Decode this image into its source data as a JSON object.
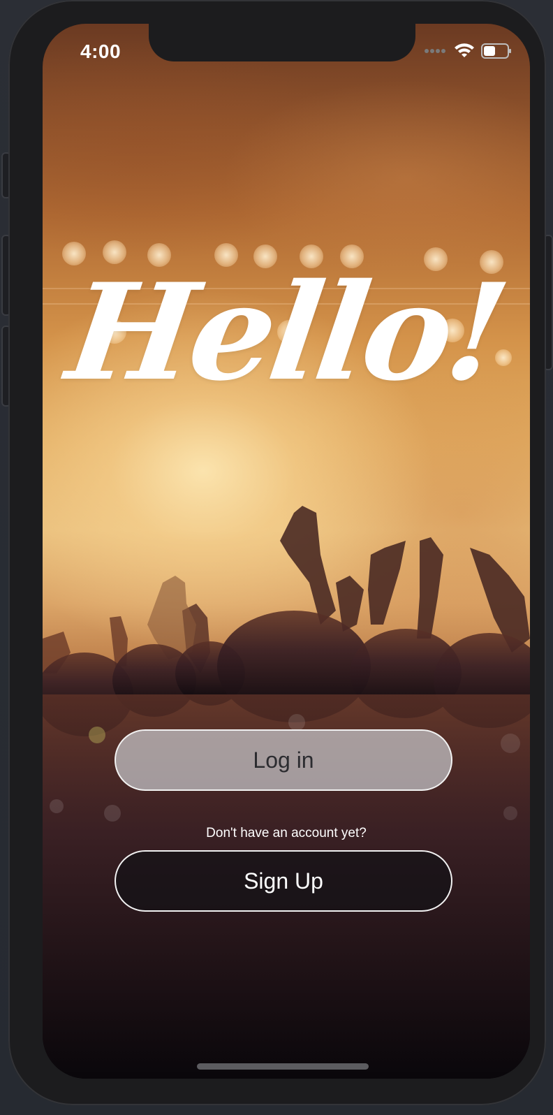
{
  "status_bar": {
    "time": "4:00",
    "icons": [
      "signal-dots-icon",
      "wifi-icon",
      "battery-icon"
    ]
  },
  "welcome": {
    "title": "Hello!"
  },
  "actions": {
    "login_label": "Log in",
    "no_account_text": "Don't have an account yet?",
    "signup_label": "Sign Up"
  },
  "colors": {
    "login_button_bg": "#c8c8cc",
    "signup_button_bg": "#141216",
    "button_border": "#f2f2f2",
    "text_light": "#ffffff",
    "text_dark": "#2c2c30"
  }
}
